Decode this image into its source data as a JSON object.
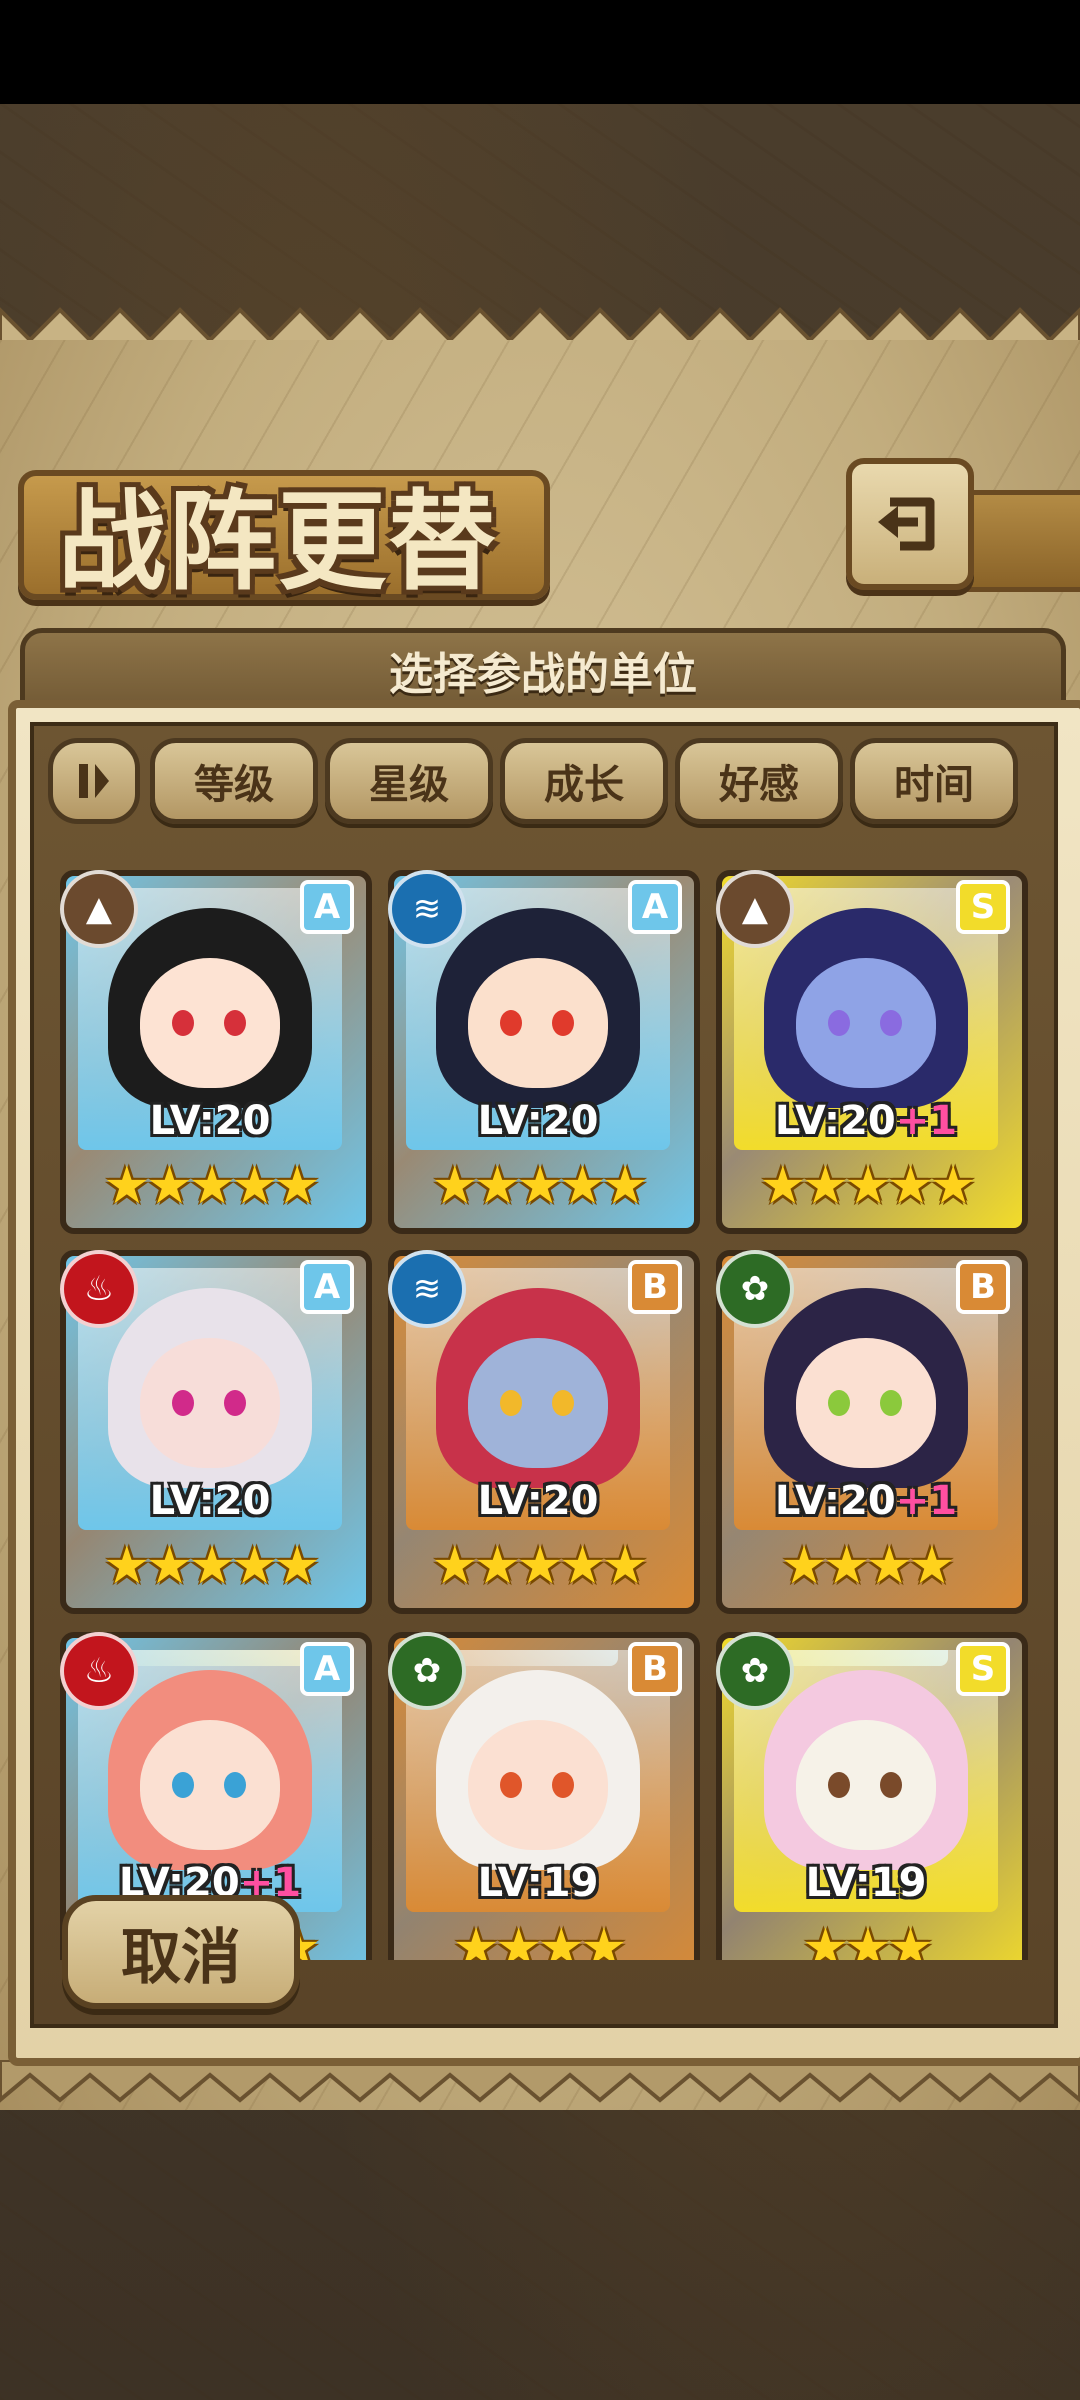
{
  "header": {
    "title": "战阵更替",
    "back_icon": "return-arrow-icon"
  },
  "subtitle": "选择参战的单位",
  "sort_bar": {
    "toggle_icon": "pause-toggle-icon",
    "buttons": [
      "等级",
      "星级",
      "成长",
      "好感",
      "时间"
    ]
  },
  "cards": [
    {
      "level": "LV:20",
      "plus": "",
      "rank": "A",
      "element": "earth",
      "stars": "★★★★★",
      "theme": "blue",
      "hair": "#1c1c1c",
      "skin": "#fde3d3",
      "eye": "#d6303a"
    },
    {
      "level": "LV:20",
      "plus": "",
      "rank": "A",
      "element": "water",
      "stars": "★★★★★",
      "theme": "blue",
      "hair": "#1e2238",
      "skin": "#fbe0cc",
      "eye": "#e03a2c"
    },
    {
      "level": "LV:20",
      "plus": "+1",
      "rank": "S",
      "element": "earth",
      "stars": "★★★★★",
      "theme": "gold",
      "hair": "#2a2a6a",
      "skin": "#8fa3e6",
      "eye": "#8a6be0"
    },
    {
      "level": "LV:20",
      "plus": "",
      "rank": "A",
      "element": "fire",
      "stars": "★★★★★",
      "theme": "blue",
      "hair": "#e8e2ea",
      "skin": "#f7ddd9",
      "eye": "#d12a8a"
    },
    {
      "level": "LV:20",
      "plus": "",
      "rank": "B",
      "element": "water",
      "stars": "★★★★★",
      "theme": "bronze",
      "hair": "#c8324a",
      "skin": "#9fb3d9",
      "eye": "#f2b82a"
    },
    {
      "level": "LV:20",
      "plus": "+1",
      "rank": "B",
      "element": "wind",
      "stars": "★★★★",
      "theme": "bronze",
      "hair": "#2c2446",
      "skin": "#fbe0d2",
      "eye": "#8bc93c"
    },
    {
      "level": "LV:20",
      "plus": "+1",
      "rank": "A",
      "element": "fire",
      "stars": "★★★★★",
      "theme": "blue",
      "hair": "#f28d7e",
      "skin": "#fbe0d2",
      "eye": "#3aa2d6"
    },
    {
      "level": "LV:19",
      "plus": "",
      "rank": "B",
      "element": "wind",
      "stars": "★★★★",
      "theme": "bronze",
      "hair": "#f3f0ec",
      "skin": "#fbe0d2",
      "eye": "#e0562a"
    },
    {
      "level": "LV:19",
      "plus": "",
      "rank": "S",
      "element": "wind",
      "stars": "★★★",
      "theme": "gold",
      "hair": "#f4c9e0",
      "skin": "#f6f2e8",
      "eye": "#7a4a2a"
    }
  ],
  "element_glyphs": {
    "earth": "▲",
    "water": "≋",
    "fire": "♨",
    "wind": "✿"
  },
  "element_colors": {
    "earth": "#6b4a2e",
    "water": "#1b6fb0",
    "fire": "#c2151d",
    "wind": "#2d6b25"
  },
  "theme_colors": {
    "blue": "#6ec6ea",
    "gold": "#f2dc2a",
    "bronze": "#d98a35"
  },
  "cancel_label": "取消"
}
